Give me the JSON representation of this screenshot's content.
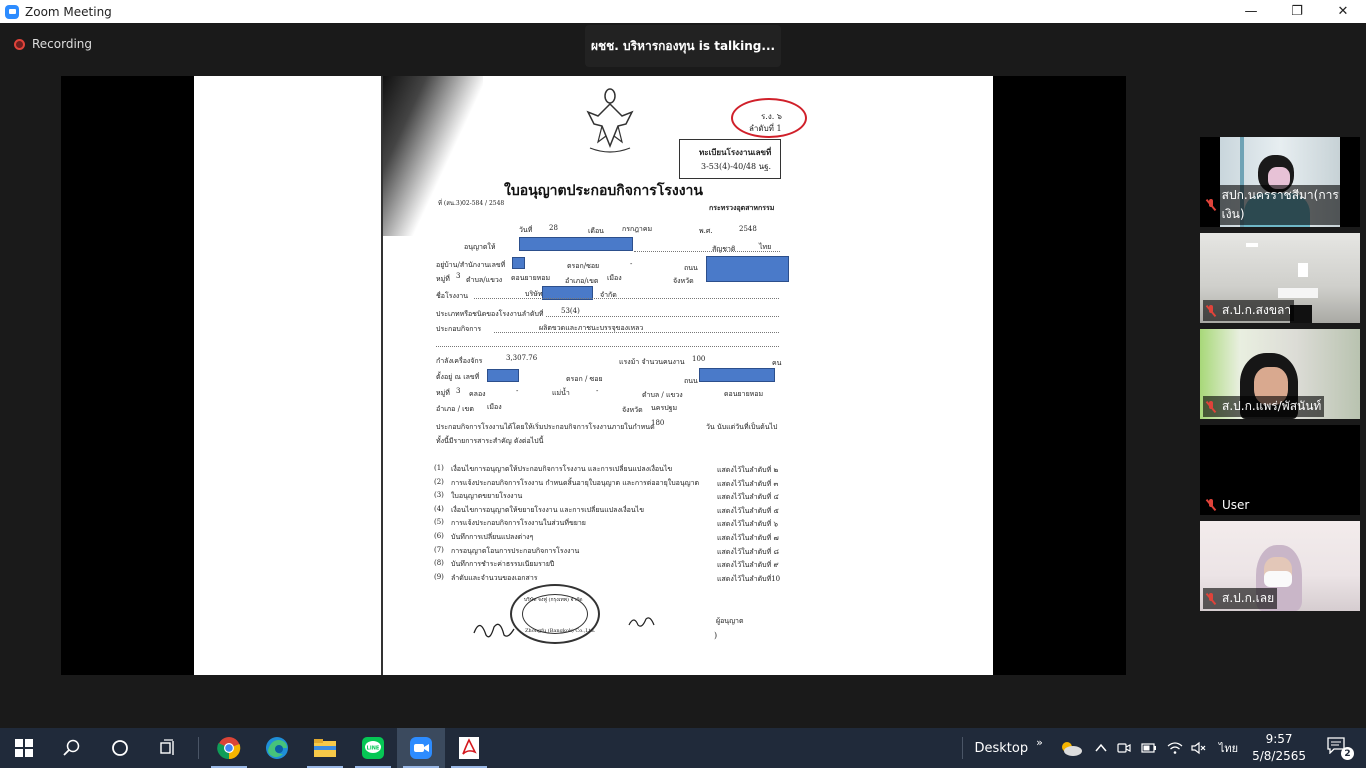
{
  "window": {
    "title": "Zoom Meeting",
    "minimize": "—",
    "maximize": "❐",
    "close": "✕"
  },
  "meeting": {
    "recording_label": "Recording",
    "talking_text": "ผชช. บริหารกองทุน is talking..."
  },
  "document": {
    "corner_code": "ร.ง. ๖",
    "corner_order": "ลำดับที่ 1",
    "reg_label": "ทะเบียนโรงงานเลขที่",
    "reg_number": "3-53(4)-40/48 นฐ.",
    "title": "ใบอนุญาตประกอบกิจการโรงงาน",
    "ref_number": "ที่ (สน.3)02-584 / 2548",
    "ministry": "กระทรวงอุตสาหกรรม",
    "date_label": "วันที่",
    "day": "28",
    "month_label": "เดือน",
    "month": "กรกฎาคม",
    "year_label": "พ.ศ.",
    "year": "2548",
    "licensee_label": "อนุญาตให้",
    "nationality_label": "สัญชาติ",
    "nationality": "ไทย",
    "address_label": "อยู่บ้าน/สำนักงานเลขที่",
    "lane_label": "ตรอก/ซอย",
    "lane_value": "-",
    "road_label": "ถนน",
    "moo_label": "หมู่ที่",
    "moo": "3",
    "subdistrict_label": "ตำบล/แขวง",
    "subdistrict": "ดอนยายหอม",
    "district_label": "อำเภอ/เขต",
    "district": "เมือง",
    "province_label": "จังหวัด",
    "factory_name_label": "ชื่อโรงงาน",
    "company_prefix": "บริษัท",
    "company_suffix": "จำกัด",
    "type_label": "ประเภทหรือชนิดของโรงงานลำดับที่",
    "type_value": "53(4)",
    "business_label": "ประกอบกิจการ",
    "business_value": "ผลิตขวดและภาชนะบรรจุของเหลว",
    "power_label": "กำลังเครื่องจักร",
    "power_value": "3,307.76",
    "hp_label": "แรงม้า จำนวนคนงาน",
    "workers": "100",
    "workers_unit": "คน",
    "located_label": "ตั้งอยู่ ณ เลขที่",
    "lane2_label": "ตรอก / ซอย",
    "road2_label": "ถนน",
    "moo2": "3",
    "canal_label": "คลอง",
    "canal_value": "-",
    "river_label": "แม่น้ำ",
    "river_value": "-",
    "subdistrict2_label": "ตำบล / แขวง",
    "subdistrict2": "ดอนยายหอม",
    "district2_label": "อำเภอ / เขต",
    "district2": "เมือง",
    "province2_label": "จังหวัด",
    "province2": "นครปฐม",
    "start_text": "ประกอบกิจการโรงงานได้โดยให้เริ่มประกอบกิจการโรงงานภายในกำหนด",
    "start_days": "180",
    "start_suffix": "วัน นับแต่วันที่เป็นต้นไป",
    "conditions_text": "ทั้งนี้มีรายการสาระสำคัญ ดังต่อไปนี้",
    "items": [
      {
        "num": "(1)",
        "text": "เงื่อนไขการอนุญาตให้ประกอบกิจการโรงงาน และการเปลี่ยนแปลงเงื่อนไข",
        "ref": "แสดงไว้ในลำดับที่ ๒"
      },
      {
        "num": "(2)",
        "text": "การแจ้งประกอบกิจการโรงงาน กำหนดสิ้นอายุใบอนุญาต และการต่ออายุใบอนุญาต",
        "ref": "แสดงไว้ในลำดับที่ ๓"
      },
      {
        "num": "(3)",
        "text": "ใบอนุญาตขยายโรงงาน",
        "ref": "แสดงไว้ในลำดับที่ ๔"
      },
      {
        "num": "(4)",
        "text": "เงื่อนไขการอนุญาตให้ขยายโรงงาน และการเปลี่ยนแปลงเงื่อนไข",
        "ref": "แสดงไว้ในลำดับที่ ๕"
      },
      {
        "num": "(5)",
        "text": "การแจ้งประกอบกิจการโรงงานในส่วนที่ขยาย",
        "ref": "แสดงไว้ในลำดับที่ ๖"
      },
      {
        "num": "(6)",
        "text": "บันทึกการเปลี่ยนแปลงต่างๆ",
        "ref": "แสดงไว้ในลำดับที่ ๗"
      },
      {
        "num": "(7)",
        "text": "การอนุญาตโอนการประกอบกิจการโรงงาน",
        "ref": "แสดงไว้ในลำดับที่ ๘"
      },
      {
        "num": "(8)",
        "text": "บันทึกการชำระค่าธรรมเนียมรายปี",
        "ref": "แสดงไว้ในลำดับที่ ๙"
      },
      {
        "num": "(9)",
        "text": "ลำดับและจำนวนของเอกสาร",
        "ref": "แสดงไว้ในลำดับที่10"
      }
    ],
    "licensee_sign": "ผู้อนุญาต",
    "seal_text": "บริษัท จงฟู (กรุงเทพ) จำกัด",
    "seal_en": "Zhongfu (Bangkok) Co.,Ltd."
  },
  "participants": [
    {
      "name": "สปก.นครราชสีมา(การเงิน)",
      "muted": true
    },
    {
      "name": "ส.ป.ก.สงขลา",
      "muted": true
    },
    {
      "name": "ส.ป.ก.แพร่/พัสนันท์",
      "muted": true
    },
    {
      "name": "User",
      "muted": true
    },
    {
      "name": "ส.ป.ก.เลย",
      "muted": true
    }
  ],
  "taskbar": {
    "apps": [
      "start-icon",
      "search-icon",
      "cortana-icon",
      "task-view-icon",
      "chrome-icon",
      "edge-icon",
      "file-explorer-icon",
      "line-icon",
      "zoom-icon",
      "acrobat-icon"
    ],
    "desktop_label": "Desktop",
    "chevron": "»",
    "lang": "ไทย",
    "time": "9:57",
    "date": "5/8/2565",
    "notification_count": "2"
  },
  "colors": {
    "zoom_blue": "#2d8cff",
    "muted_red": "#e0433a",
    "redaction_blue": "#4a7ac9",
    "taskbar": "#202a3a"
  }
}
